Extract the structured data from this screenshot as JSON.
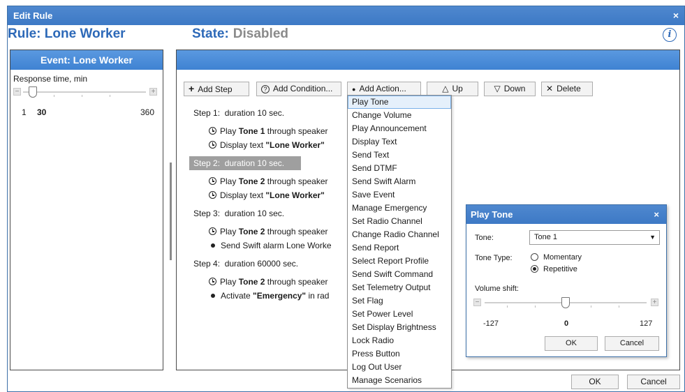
{
  "window": {
    "title": "Edit Rule",
    "close_glyph": "×"
  },
  "header": {
    "rule_label": "Rule: Lone Worker",
    "state_label": "State:",
    "state_value": "Disabled",
    "info_glyph": "i"
  },
  "event_panel": {
    "title": "Event: Lone Worker",
    "response_label": "Response time, min",
    "slider": {
      "minus": "−",
      "plus": "+",
      "min": "1",
      "value": "30",
      "max": "360",
      "value_fraction": 0.08
    }
  },
  "toolbar": {
    "add_step": "Add Step",
    "add_step_icon": "+",
    "add_condition": "Add Condition...",
    "add_condition_icon": "?",
    "add_action": "Add Action...",
    "add_action_icon": "●",
    "up": "Up",
    "up_icon": "△",
    "down": "Down",
    "down_icon": "▽",
    "delete": "Delete",
    "delete_icon": "✕"
  },
  "steps": [
    {
      "label": "Step 1:",
      "duration": "duration 10 sec."
    },
    {
      "label": "Step 2:",
      "duration": "duration 10 sec."
    },
    {
      "label": "Step 3:",
      "duration": "duration 10 sec."
    },
    {
      "label": "Step 4:",
      "duration": "duration 60000 sec."
    }
  ],
  "actions": {
    "s1a1": {
      "pre": "Play ",
      "bold": "Tone 1",
      "post": " through speaker"
    },
    "s1a2": {
      "pre": "Display text ",
      "bold": "\"Lone Worker\"",
      "post": ""
    },
    "s2a1": {
      "pre": "Play ",
      "bold": "Tone 2",
      "post": " through speaker"
    },
    "s2a2": {
      "pre": "Display text ",
      "bold": "\"Lone Worker\"",
      "post": ""
    },
    "s3a1": {
      "pre": "Play ",
      "bold": "Tone 2",
      "post": " through speaker"
    },
    "s3a2": {
      "pre": "Send Swift alarm Lone Worke",
      "bold": "",
      "post": ""
    },
    "s4a1": {
      "pre": "Play ",
      "bold": "Tone 2",
      "post": " through speaker"
    },
    "s4a2": {
      "pre": "Activate ",
      "bold": "\"Emergency\"",
      "post": " in rad"
    }
  },
  "action_menu": [
    "Play Tone",
    "Change Volume",
    "Play Announcement",
    "Display Text",
    "Send Text",
    "Send DTMF",
    "Send Swift Alarm",
    "Save Event",
    "Manage Emergency",
    "Set Radio Channel",
    "Change Radio Channel",
    "Send Report",
    "Select Report Profile",
    "Send Swift Command",
    "Set Telemetry Output",
    "Set Flag",
    "Set Power Level",
    "Set Display Brightness",
    "Lock Radio",
    "Press Button",
    "Log Out User",
    "Manage Scenarios"
  ],
  "footer": {
    "ok": "OK",
    "cancel": "Cancel"
  },
  "play_tone_dialog": {
    "title": "Play Tone",
    "close_glyph": "×",
    "tone_label": "Tone:",
    "tone_value": "Tone 1",
    "tone_arrow": "▼",
    "tone_type_label": "Tone Type:",
    "momentary": "Momentary",
    "repetitive": "Repetitive",
    "selected_type": "Repetitive",
    "volume_label": "Volume shift:",
    "volume": {
      "minus": "−",
      "plus": "+",
      "min": "-127",
      "value": "0",
      "max": "127",
      "value_fraction": 0.5
    },
    "ok": "OK",
    "cancel": "Cancel"
  }
}
